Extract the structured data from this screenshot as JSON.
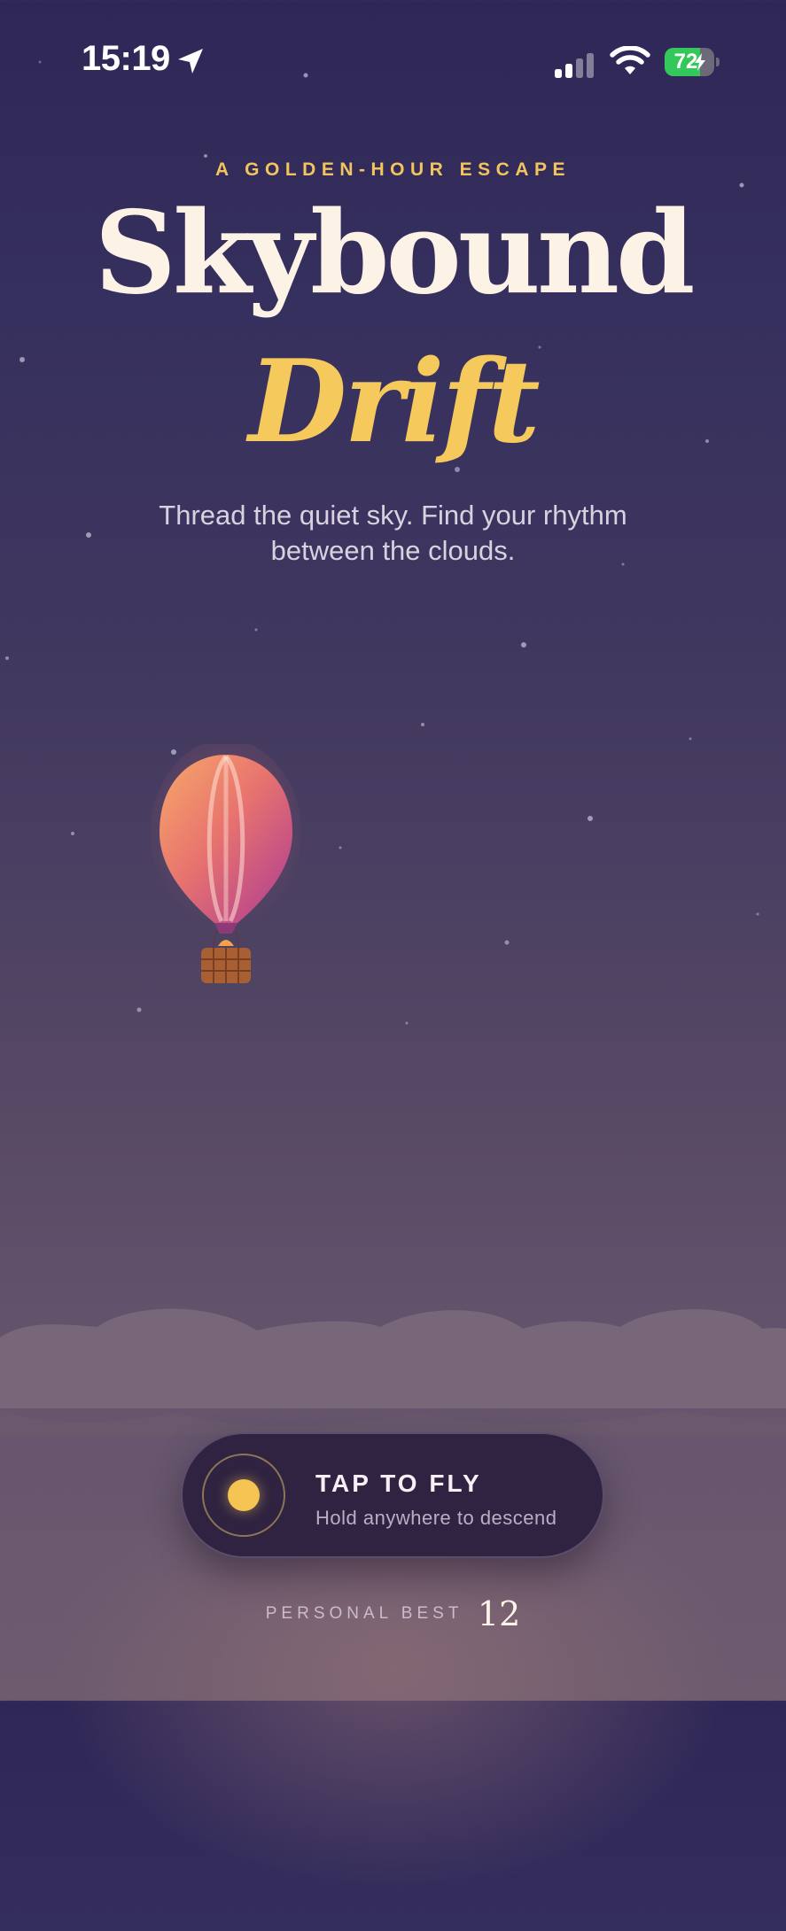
{
  "status_bar": {
    "time": "15:19",
    "battery_level": "72",
    "battery_fraction": 0.72,
    "signal_bars_active": 2,
    "signal_bars_total": 4,
    "battery_color": "#34c759"
  },
  "hero": {
    "eyebrow": "A GOLDEN-HOUR ESCAPE",
    "title": "Skybound",
    "subtitle": "Drift",
    "tagline": "Thread the quiet sky. Find your rhythm between the clouds."
  },
  "play": {
    "label": "TAP TO FLY",
    "hint": "Hold anywhere to descend",
    "accent_color": "#f6c453"
  },
  "personal_best": {
    "label": "PERSONAL BEST",
    "value": "12"
  },
  "icons": [
    "location-arrow-icon",
    "cellular-signal-icon",
    "wifi-icon",
    "battery-icon",
    "charging-bolt-icon",
    "sun-icon",
    "hot-air-balloon-icon"
  ]
}
